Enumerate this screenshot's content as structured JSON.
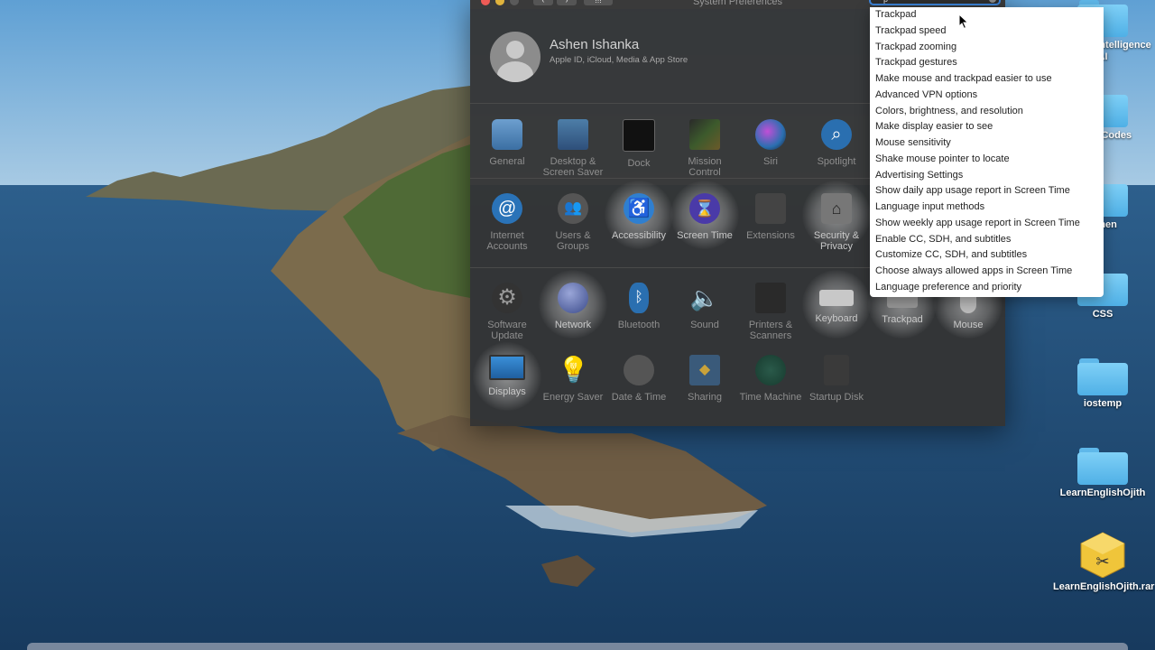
{
  "window": {
    "title": "System Preferences",
    "search_value": "p"
  },
  "user": {
    "name": "Ashen Ishanka",
    "subtitle": "Apple ID, iCloud, Media & App Store"
  },
  "prefs": [
    {
      "label": "General",
      "icon": "general-icon"
    },
    {
      "label": "Desktop & Screen Saver",
      "icon": "desktop-icon"
    },
    {
      "label": "Dock",
      "icon": "dock-icon"
    },
    {
      "label": "Mission Control",
      "icon": "mission-control-icon"
    },
    {
      "label": "Siri",
      "icon": "siri-icon"
    },
    {
      "label": "Spotlight",
      "icon": "spotlight-icon"
    },
    {
      "label": "Internet Accounts",
      "icon": "at-icon"
    },
    {
      "label": "Users & Groups",
      "icon": "users-icon"
    },
    {
      "label": "Accessibility",
      "icon": "accessibility-icon"
    },
    {
      "label": "Screen Time",
      "icon": "hourglass-icon"
    },
    {
      "label": "Extensions",
      "icon": "puzzle-icon"
    },
    {
      "label": "Security & Privacy",
      "icon": "lock-house-icon"
    },
    {
      "label": "Software Update",
      "icon": "gear-icon"
    },
    {
      "label": "Network",
      "icon": "globe-icon"
    },
    {
      "label": "Bluetooth",
      "icon": "bluetooth-icon"
    },
    {
      "label": "Sound",
      "icon": "speaker-icon"
    },
    {
      "label": "Printers & Scanners",
      "icon": "printer-icon"
    },
    {
      "label": "Keyboard",
      "icon": "keyboard-icon"
    },
    {
      "label": "Trackpad",
      "icon": "trackpad-icon"
    },
    {
      "label": "Mouse",
      "icon": "mouse-icon"
    },
    {
      "label": "Displays",
      "icon": "display-icon"
    },
    {
      "label": "Energy Saver",
      "icon": "bulb-icon"
    },
    {
      "label": "Date & Time",
      "icon": "calendar-clock-icon"
    },
    {
      "label": "Sharing",
      "icon": "sharing-folder-icon"
    },
    {
      "label": "Time Machine",
      "icon": "time-machine-icon"
    },
    {
      "label": "Startup Disk",
      "icon": "disk-icon"
    }
  ],
  "search_results": [
    "Trackpad",
    "Trackpad speed",
    "Trackpad zooming",
    "Trackpad gestures",
    "Make mouse and trackpad easier to use",
    "Advanced VPN options",
    "Colors, brightness, and resolution",
    "Make display easier to see",
    "Mouse sensitivity",
    "Shake mouse pointer to locate",
    "Advertising Settings",
    "Show daily app usage report in Screen Time",
    "Language input methods",
    "Show weekly app usage report in Screen Time",
    "Enable CC, SDH, and subtitles",
    "Customize CC, SDH, and subtitles",
    "Choose always allowed apps in Screen Time",
    "Language preference and priority"
  ],
  "desktop_icons": [
    {
      "label": "Artificial Intelligence AI"
    },
    {
      "label": "AppleCodes"
    },
    {
      "label": "ashen"
    },
    {
      "label": "CSS"
    },
    {
      "label": "iostemp"
    },
    {
      "label": "LearnEnglishOjith"
    },
    {
      "label": "LearnEnglishOjith.rar"
    }
  ]
}
